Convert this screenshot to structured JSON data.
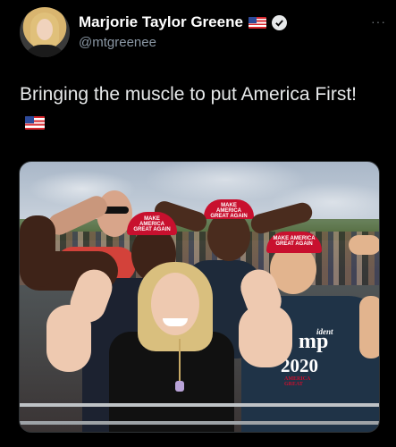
{
  "author": {
    "name": "Marjorie Taylor Greene",
    "handle": "@mtgreenee",
    "badges": [
      "us-flag-icon",
      "verified-icon"
    ]
  },
  "menu": {
    "more_label": "···"
  },
  "tweet": {
    "text": "Bringing the muscle to put America First!",
    "emoji": "us-flag-icon"
  },
  "photo": {
    "hat_text_1": "MAKE AMERICA GREAT AGAIN",
    "hat_text_2": "MAKE AMERICA GREAT AGAIN",
    "hat_text_3": "MAKE AMERICA GREAT AGAIN",
    "shirt_small": "ident",
    "shirt_word": "mp",
    "shirt_year": "2020",
    "shirt_bottom": "AMERICA GREAT"
  },
  "colors": {
    "background": "#000000",
    "text": "#e7e9ea",
    "secondary_text": "#8b98a5",
    "maga_red": "#c8102e"
  }
}
